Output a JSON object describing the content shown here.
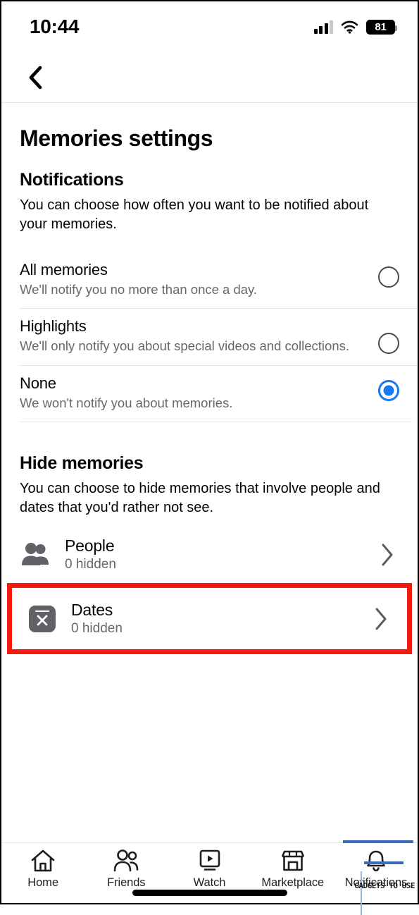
{
  "status_bar": {
    "time": "10:44",
    "battery_level": "81",
    "signal_icon": "cellular-signal-icon",
    "wifi_icon": "wifi-icon",
    "battery_icon": "battery-icon"
  },
  "nav": {
    "back_icon": "back-chevron-icon"
  },
  "page": {
    "title": "Memories settings"
  },
  "notifications": {
    "heading": "Notifications",
    "description": "You can choose how often you want to be notified about your memories.",
    "options": [
      {
        "title": "All memories",
        "subtitle": "We'll notify you no more than once a day.",
        "selected": false
      },
      {
        "title": "Highlights",
        "subtitle": "We'll only notify you about special videos and collections.",
        "selected": false
      },
      {
        "title": "None",
        "subtitle": "We won't notify you about memories.",
        "selected": true
      }
    ]
  },
  "hide_memories": {
    "heading": "Hide memories",
    "description": "You can choose to hide memories that involve people and dates that you'd rather not see.",
    "rows": [
      {
        "title": "People",
        "subtitle": "0 hidden",
        "icon": "people-icon",
        "highlighted": false
      },
      {
        "title": "Dates",
        "subtitle": "0 hidden",
        "icon": "calendar-x-icon",
        "highlighted": true
      }
    ]
  },
  "tabbar": {
    "items": [
      {
        "label": "Home",
        "icon": "home-icon"
      },
      {
        "label": "Friends",
        "icon": "friends-icon"
      },
      {
        "label": "Watch",
        "icon": "watch-play-icon"
      },
      {
        "label": "Marketplace",
        "icon": "marketplace-storefront-icon"
      },
      {
        "label": "Notifications",
        "icon": "bell-icon"
      }
    ]
  },
  "watermark": {
    "text": "GADGETS TO USE"
  },
  "colors": {
    "accent_blue": "#1877f2",
    "highlight_red": "#f51a0f",
    "secondary_text": "#65676b",
    "icon_gray": "#606266"
  }
}
